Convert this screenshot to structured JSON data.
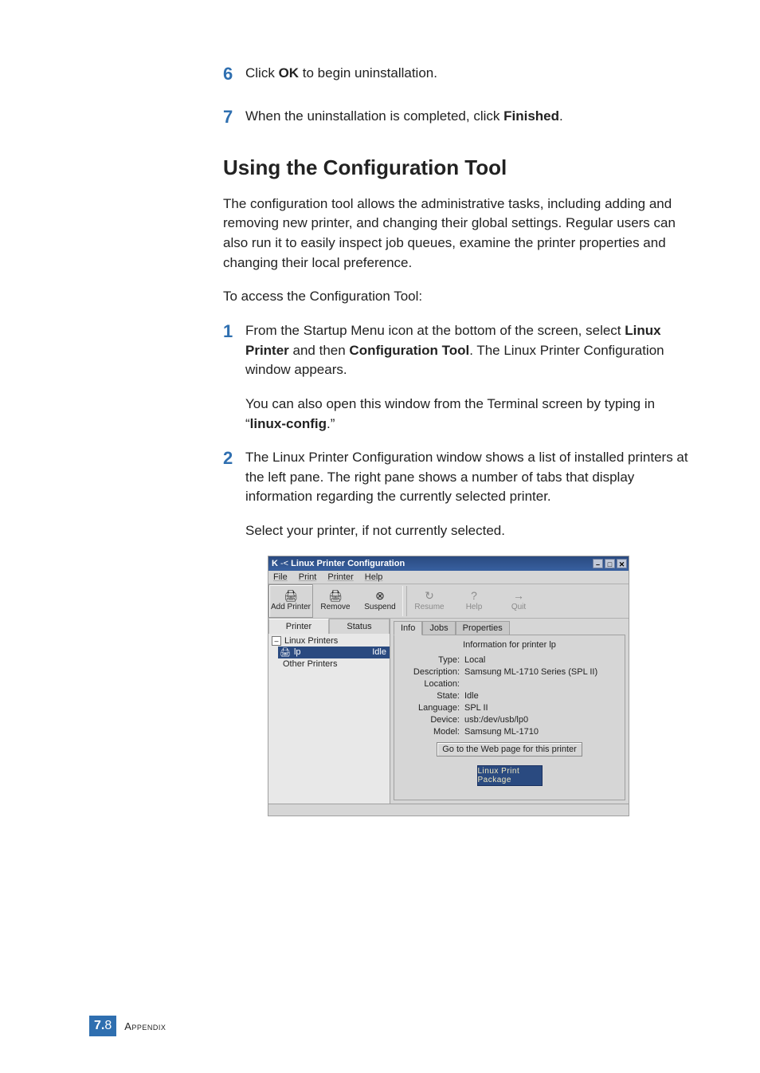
{
  "steps_top": [
    {
      "num": "6",
      "pre": "Click ",
      "bold": "OK",
      "post": " to begin uninstallation."
    },
    {
      "num": "7",
      "pre": "When the uninstallation is completed, click ",
      "bold": "Finished",
      "post": "."
    }
  ],
  "section_title": "Using the Configuration Tool",
  "para1": "The configuration tool allows the administrative tasks, including adding and removing new printer, and changing their global settings. Regular users can also run it to easily inspect job queues, examine the printer properties and changing their local preference.",
  "para2": "To access the Configuration Tool:",
  "step1": {
    "num": "1",
    "line1_pre": "From the Startup Menu icon at the bottom of the screen, select ",
    "line1_b1": "Linux Printer",
    "line1_mid": " and then ",
    "line1_b2": "Configuration Tool",
    "line1_post": ". The Linux Printer Configuration window appears.",
    "line2_pre": "You can also open this window from the Terminal screen by typing in “",
    "line2_b": "linux-config",
    "line2_post": ".”"
  },
  "step2": {
    "num": "2",
    "line1": "The Linux Printer Configuration window shows a list of installed printers at the left pane. The right pane shows a number of tabs that display information regarding the currently selected printer.",
    "line2": "Select your printer, if not currently selected."
  },
  "window": {
    "title_prefix": "K",
    "title": "Linux Printer Configuration",
    "win_min": "–",
    "win_max": "□",
    "win_close": "✕",
    "menu": {
      "file": "File",
      "print": "Print",
      "printer": "Printer",
      "help": "Help"
    },
    "toolbar": {
      "add": "Add Printer",
      "remove": "Remove",
      "suspend": "Suspend",
      "resume": "Resume",
      "help": "Help",
      "quit": "Quit"
    },
    "left_tabs": {
      "printer": "Printer",
      "status": "Status"
    },
    "tree": {
      "root1": "Linux Printers",
      "lp": "lp",
      "lp_status": "Idle",
      "root2": "Other Printers"
    },
    "right_tabs": {
      "info": "Info",
      "jobs": "Jobs",
      "properties": "Properties"
    },
    "info_title": "Information for printer lp",
    "info": {
      "type_k": "Type:",
      "type_v": "Local",
      "desc_k": "Description:",
      "desc_v": "Samsung ML-1710 Series (SPL II)",
      "loc_k": "Location:",
      "loc_v": "",
      "state_k": "State:",
      "state_v": "Idle",
      "lang_k": "Language:",
      "lang_v": "SPL II",
      "dev_k": "Device:",
      "dev_v": "usb:/dev/usb/lp0",
      "model_k": "Model:",
      "model_v": "Samsung ML-1710"
    },
    "go_button": "Go to the Web page for this printer",
    "logo_text": "Linux Print Package"
  },
  "footer": {
    "chapter": "7.",
    "page": "8",
    "label": "Appendix"
  }
}
